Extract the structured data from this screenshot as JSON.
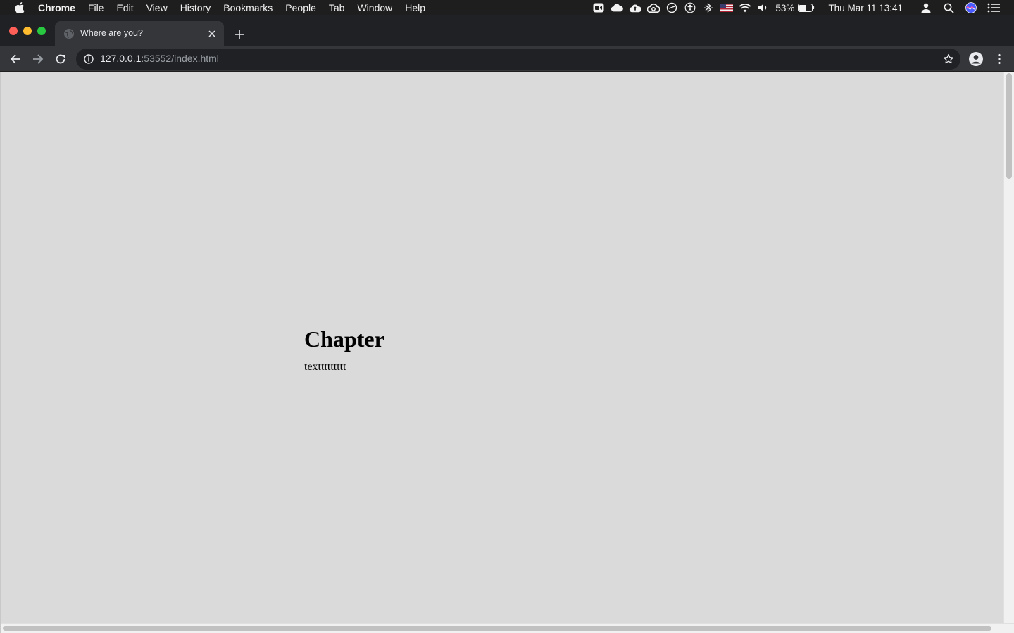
{
  "menubar": {
    "app_name": "Chrome",
    "items": [
      "File",
      "Edit",
      "View",
      "History",
      "Bookmarks",
      "People",
      "Tab",
      "Window",
      "Help"
    ],
    "battery_percent": "53%",
    "clock": "Thu Mar 11  13:41",
    "status_icons": [
      "zoom-icon",
      "cloud-icon",
      "cloud-upload-icon",
      "creative-cloud-icon",
      "sync-icon",
      "accessibility-icon",
      "bluetooth-icon",
      "us-flag-icon",
      "wifi-icon",
      "volume-icon",
      "battery-icon",
      "user-icon",
      "spotlight-icon",
      "siri-icon",
      "control-center-icon"
    ]
  },
  "tab": {
    "title": "Where are you?"
  },
  "address_bar": {
    "host": "127.0.0.1",
    "path": ":53552/index.html"
  },
  "page": {
    "heading": "Chapter",
    "text": "texttttttttt",
    "background": "#dadada"
  },
  "colors": {
    "tabstrip": "#202124",
    "toolbar": "#35363a",
    "close": "#ff5f57",
    "minimize": "#febc2e",
    "maximize": "#28c840"
  }
}
